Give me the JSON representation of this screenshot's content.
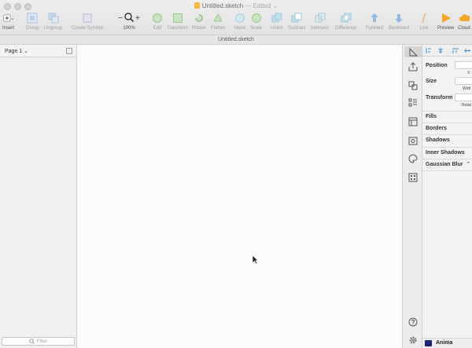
{
  "window": {
    "doc_name": "Untitled.sketch",
    "edited_suffix": "— Edited",
    "tab_title": "Untitled.sketch"
  },
  "toolbar": {
    "insert": "Insert",
    "group": "Group",
    "ungroup": "Ungroup",
    "create_symbol": "Create Symbol",
    "zoom": "100%",
    "edit": "Edit",
    "transform": "Transform",
    "rotate": "Rotate",
    "flatten": "Flatten",
    "mask": "Mask",
    "scale": "Scale",
    "union": "Union",
    "subtract": "Subtract",
    "intersect": "Intersect",
    "difference": "Difference",
    "forward": "Forward",
    "backward": "Backward",
    "link": "Link",
    "preview": "Preview",
    "cloud": "Cloud",
    "zoom_minus": "−",
    "zoom_plus": "+"
  },
  "pages_panel": {
    "current_page": "Page 1",
    "filter_placeholder": "Filter"
  },
  "inspector": {
    "position": "Position",
    "position_x": "X",
    "size": "Size",
    "size_width": "Widt",
    "transform": "Transform",
    "transform_rotate": "Rotat",
    "sections": [
      "Fills",
      "Borders",
      "Shadows",
      "Inner Shadows",
      "Gaussian Blur"
    ],
    "plugin_name": "Anima"
  },
  "colors": {
    "accent_blue": "#3c8fd8",
    "accent_green": "#7cc36a",
    "accent_orange": "#f5a623",
    "canvas": "#fcfbfd"
  }
}
